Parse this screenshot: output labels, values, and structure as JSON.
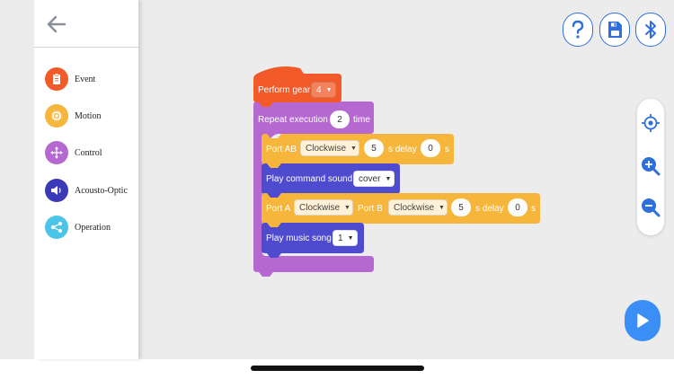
{
  "colors": {
    "event": "#f25a2a",
    "control": "#b468d0",
    "motion": "#f6b63c",
    "acousto": "#4f4bcf",
    "operation": "#59c3e6",
    "accent": "#2f6fdc",
    "run": "#3a8ef6"
  },
  "sidebar": {
    "back_icon": "arrow-left-icon",
    "categories": [
      {
        "label": "Event",
        "icon": "clipboard-icon",
        "color": "#f25a2a"
      },
      {
        "label": "Motion",
        "icon": "chip-icon",
        "color": "#f6b63c"
      },
      {
        "label": "Control",
        "icon": "move-arrows-icon",
        "color": "#b468d0"
      },
      {
        "label": "Acousto-Optic",
        "icon": "speaker-icon",
        "color": "#3a3ab8"
      },
      {
        "label": "Operation",
        "icon": "share-nodes-icon",
        "color": "#4cc4e8"
      }
    ]
  },
  "toolbar": {
    "help_icon": "question-icon",
    "save_icon": "save-icon",
    "bluetooth_icon": "bluetooth-icon"
  },
  "zoom": {
    "center_icon": "crosshair-icon",
    "zoom_in_icon": "zoom-in-icon",
    "zoom_out_icon": "zoom-out-icon"
  },
  "run": {
    "icon": "play-icon"
  },
  "blocks": {
    "hat": {
      "label": "Perform gear",
      "value": "4"
    },
    "repeat": {
      "label": "Repeat execution",
      "count": "2",
      "suffix": "time"
    },
    "port_ab": {
      "label": "Port AB",
      "direction": "Clockwise",
      "speed": "5",
      "delay_label": "s delay",
      "delay": "0",
      "unit": "s"
    },
    "sound": {
      "label": "Play command sound",
      "value": "cover"
    },
    "port_a_b": {
      "label_a": "Port A",
      "direction_a": "Clockwise",
      "label_b": "Port B",
      "direction_b": "Clockwise",
      "speed": "5",
      "delay_label": "s delay",
      "delay": "0",
      "unit": "s"
    },
    "music": {
      "label": "Play music song",
      "value": "1"
    }
  }
}
